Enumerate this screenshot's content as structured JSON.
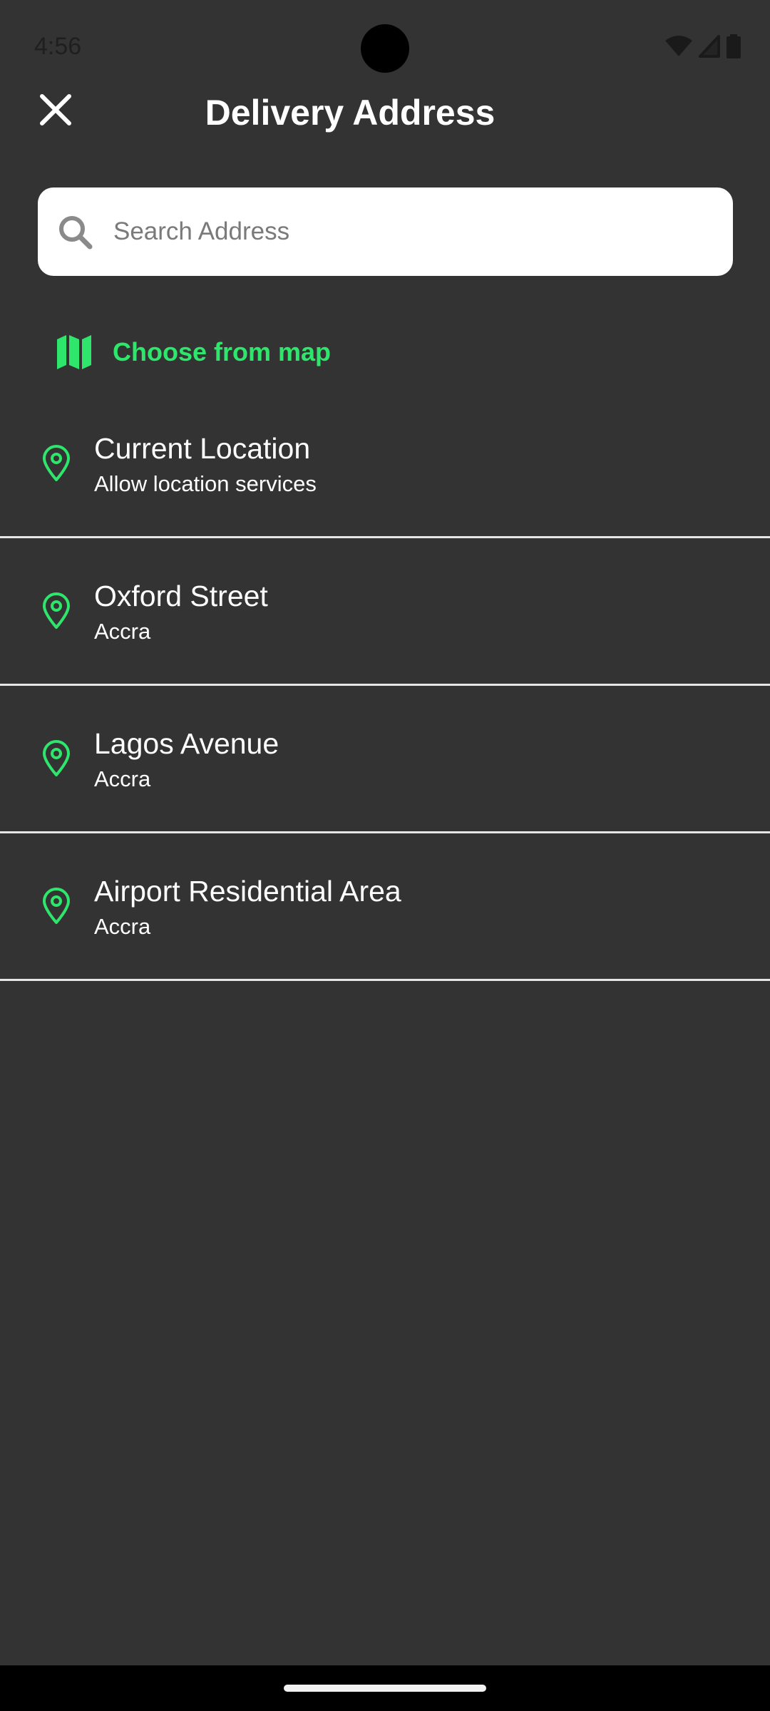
{
  "status_bar": {
    "time": "4:56"
  },
  "header": {
    "title": "Delivery Address",
    "close_icon": "close-icon"
  },
  "search": {
    "placeholder": "Search Address",
    "value": "",
    "icon": "search-icon"
  },
  "map_option": {
    "label": "Choose from map",
    "icon": "map-icon"
  },
  "addresses": [
    {
      "title": "Current Location",
      "subtitle": "Allow location services",
      "icon": "location-pin-icon"
    },
    {
      "title": "Oxford Street",
      "subtitle": "Accra",
      "icon": "location-pin-icon"
    },
    {
      "title": "Lagos Avenue",
      "subtitle": "Accra",
      "icon": "location-pin-icon"
    },
    {
      "title": "Airport Residential Area",
      "subtitle": "Accra",
      "icon": "location-pin-icon"
    }
  ],
  "colors": {
    "background": "#333333",
    "accent": "#2ee66b",
    "text": "#ffffff",
    "divider": "#e6e6e6"
  }
}
